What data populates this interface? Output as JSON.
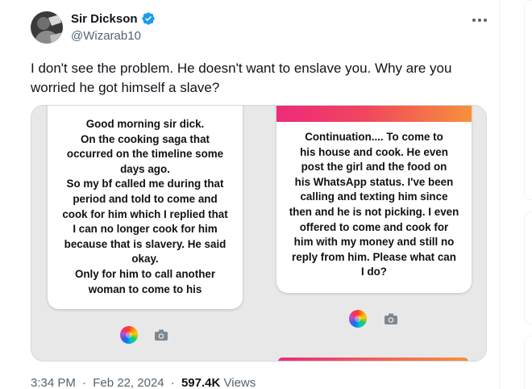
{
  "author": {
    "name": "Sir Dickson",
    "handle": "@Wizarab10",
    "verified": true,
    "avatar_icon": "avatar-photo"
  },
  "tweet": {
    "text": "I don't see the problem. He doesn't want to enslave you. Why are you worried he got himself a slave?"
  },
  "media": {
    "left_story": {
      "lines": [
        "Good morning sir dick.",
        "On the cooking saga that",
        "occurred on the timeline some",
        "days ago.",
        "So my bf called me during that",
        "period and told to come and",
        "cook for him which I replied that",
        "I can no longer cook for him",
        "because that is slavery. He said",
        "okay.",
        "Only for him to call another",
        "woman to come to his"
      ]
    },
    "right_story": {
      "lines": [
        "Continuation.... To come to",
        "his house and cook. He even",
        "post the girl and the food on",
        "his WhatsApp status. I've been",
        "calling and texting him since",
        "then and he is not picking. I even",
        "offered to come and cook for",
        "him with my money and still no",
        "reply from him. Please what can",
        "I do?"
      ]
    }
  },
  "meta": {
    "time": "3:34 PM",
    "date": "Feb 22, 2024",
    "separator": "·",
    "views_count": "597.4K",
    "views_label": "Views"
  },
  "colors": {
    "verified_blue": "#1d9bf0",
    "secondary_text": "#536471",
    "story_gradient_start": "#ee2a7b",
    "story_gradient_end": "#f7913a"
  }
}
